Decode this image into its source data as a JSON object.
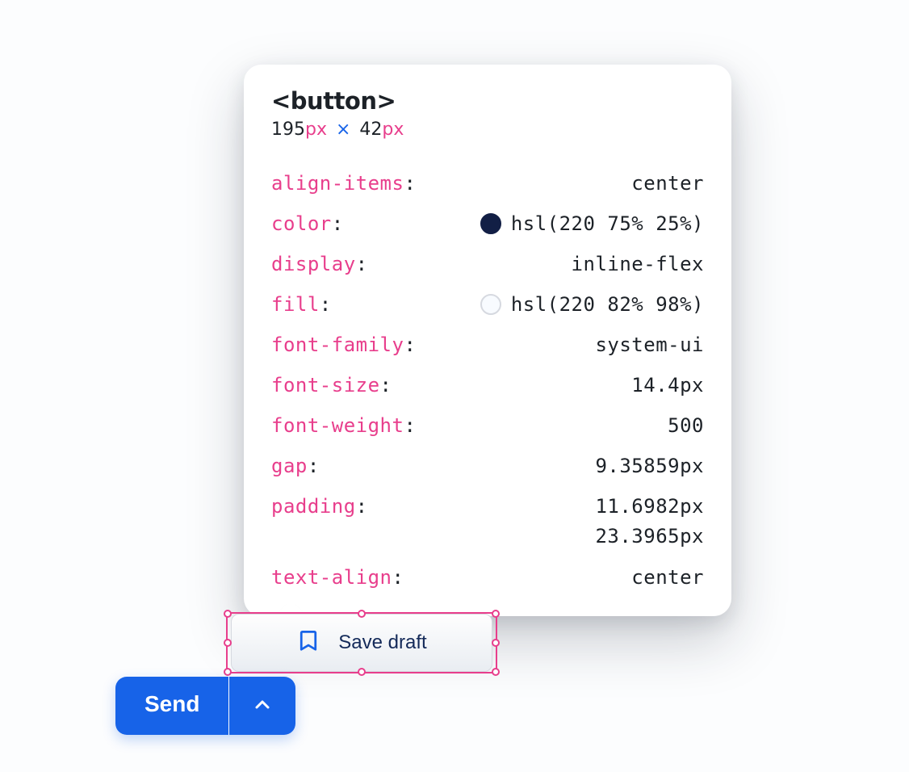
{
  "inspector": {
    "tag": "<button>",
    "dimensions": {
      "width": "195",
      "height": "42",
      "unit": "px"
    },
    "properties": [
      {
        "key": "align-items",
        "value": "center"
      },
      {
        "key": "color",
        "value": "hsl(220 75% 25%)",
        "swatch": "#121f45"
      },
      {
        "key": "display",
        "value": "inline-flex"
      },
      {
        "key": "fill",
        "value": "hsl(220 82% 98%)",
        "swatch": "#f7faff",
        "swatchLight": true
      },
      {
        "key": "font-family",
        "value": "system-ui"
      },
      {
        "key": "font-size",
        "value": "14.4px"
      },
      {
        "key": "font-weight",
        "value": "500"
      },
      {
        "key": "gap",
        "value": "9.35859px"
      },
      {
        "key": "padding",
        "value": "11.6982px\n23.3965px"
      },
      {
        "key": "text-align",
        "value": "center"
      }
    ]
  },
  "buttons": {
    "saveDraft": "Save draft",
    "send": "Send"
  }
}
